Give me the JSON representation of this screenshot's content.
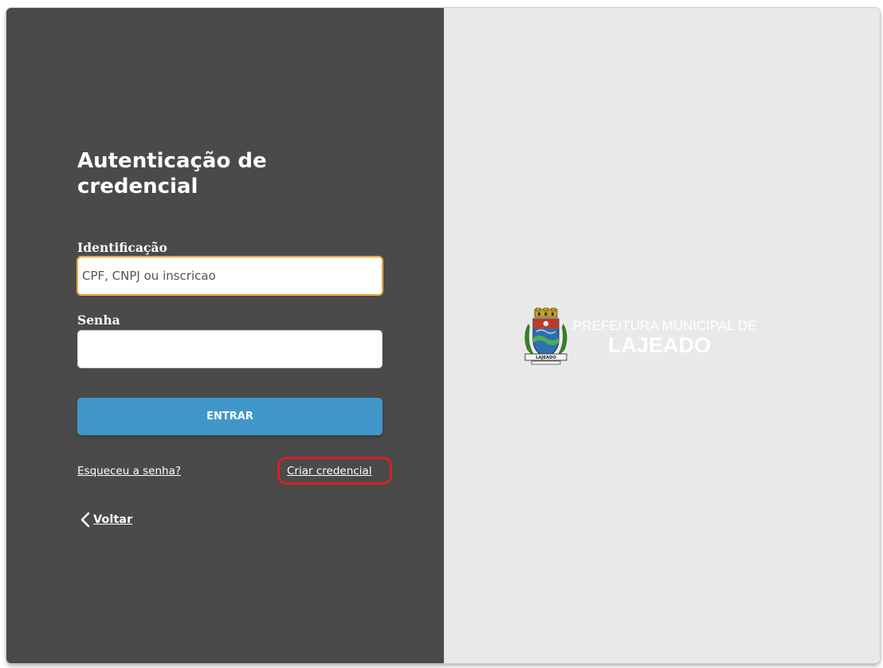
{
  "login": {
    "title": "Autenticação de credencial",
    "identification_label": "Identificação",
    "identification_placeholder": "CPF, CNPJ ou inscricao",
    "password_label": "Senha",
    "password_value": "",
    "submit_label": "ENTRAR",
    "forgot_password_link": "Esqueceu a senha?",
    "create_credential_link": "Criar credencial",
    "back_link": "Voltar"
  },
  "brand": {
    "line1": "PREFEITURA MUNICIPAL DE",
    "line2": "LAJEADO",
    "crest_text": "LAJEADO",
    "crest_icon": "municipal-coat-of-arms"
  },
  "colors": {
    "left_panel": "#4a4a4a",
    "right_panel": "#e9e9e9",
    "primary_button": "#3f97c9",
    "focus_border": "#e39a24",
    "highlight_annotation": "#d8202c"
  }
}
